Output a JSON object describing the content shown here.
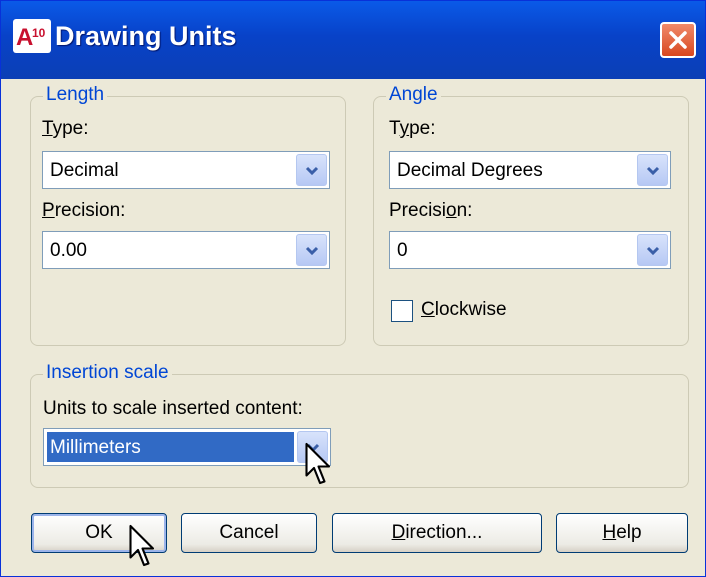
{
  "window": {
    "title": "Drawing Units",
    "app_icon": "A10"
  },
  "length": {
    "legend": "Length",
    "type_label_u": "T",
    "type_label_rest": "ype:",
    "type_value": "Decimal",
    "precision_label_u": "P",
    "precision_label_rest": "recision:",
    "precision_value": "0.00"
  },
  "angle": {
    "legend": "Angle",
    "type_label_pre": "T",
    "type_label_u": "y",
    "type_label_rest": "pe:",
    "type_value": "Decimal Degrees",
    "precision_label_pre": "Precisi",
    "precision_label_u": "o",
    "precision_label_rest": "n:",
    "precision_value": "0",
    "clockwise_u": "C",
    "clockwise_rest": "lockwise",
    "clockwise_checked": false
  },
  "insertion": {
    "legend": "Insertion scale",
    "label": "Units to scale inserted content:",
    "value": "Millimeters"
  },
  "buttons": {
    "ok": "OK",
    "cancel": "Cancel",
    "direction_u": "D",
    "direction_rest": "irection...",
    "help_u": "H",
    "help_rest": "elp"
  },
  "colors": {
    "title_bar": "#0842c8",
    "legend_text": "#0046d5",
    "selection": "#316ac5",
    "dialog_bg": "#ece9d8"
  }
}
